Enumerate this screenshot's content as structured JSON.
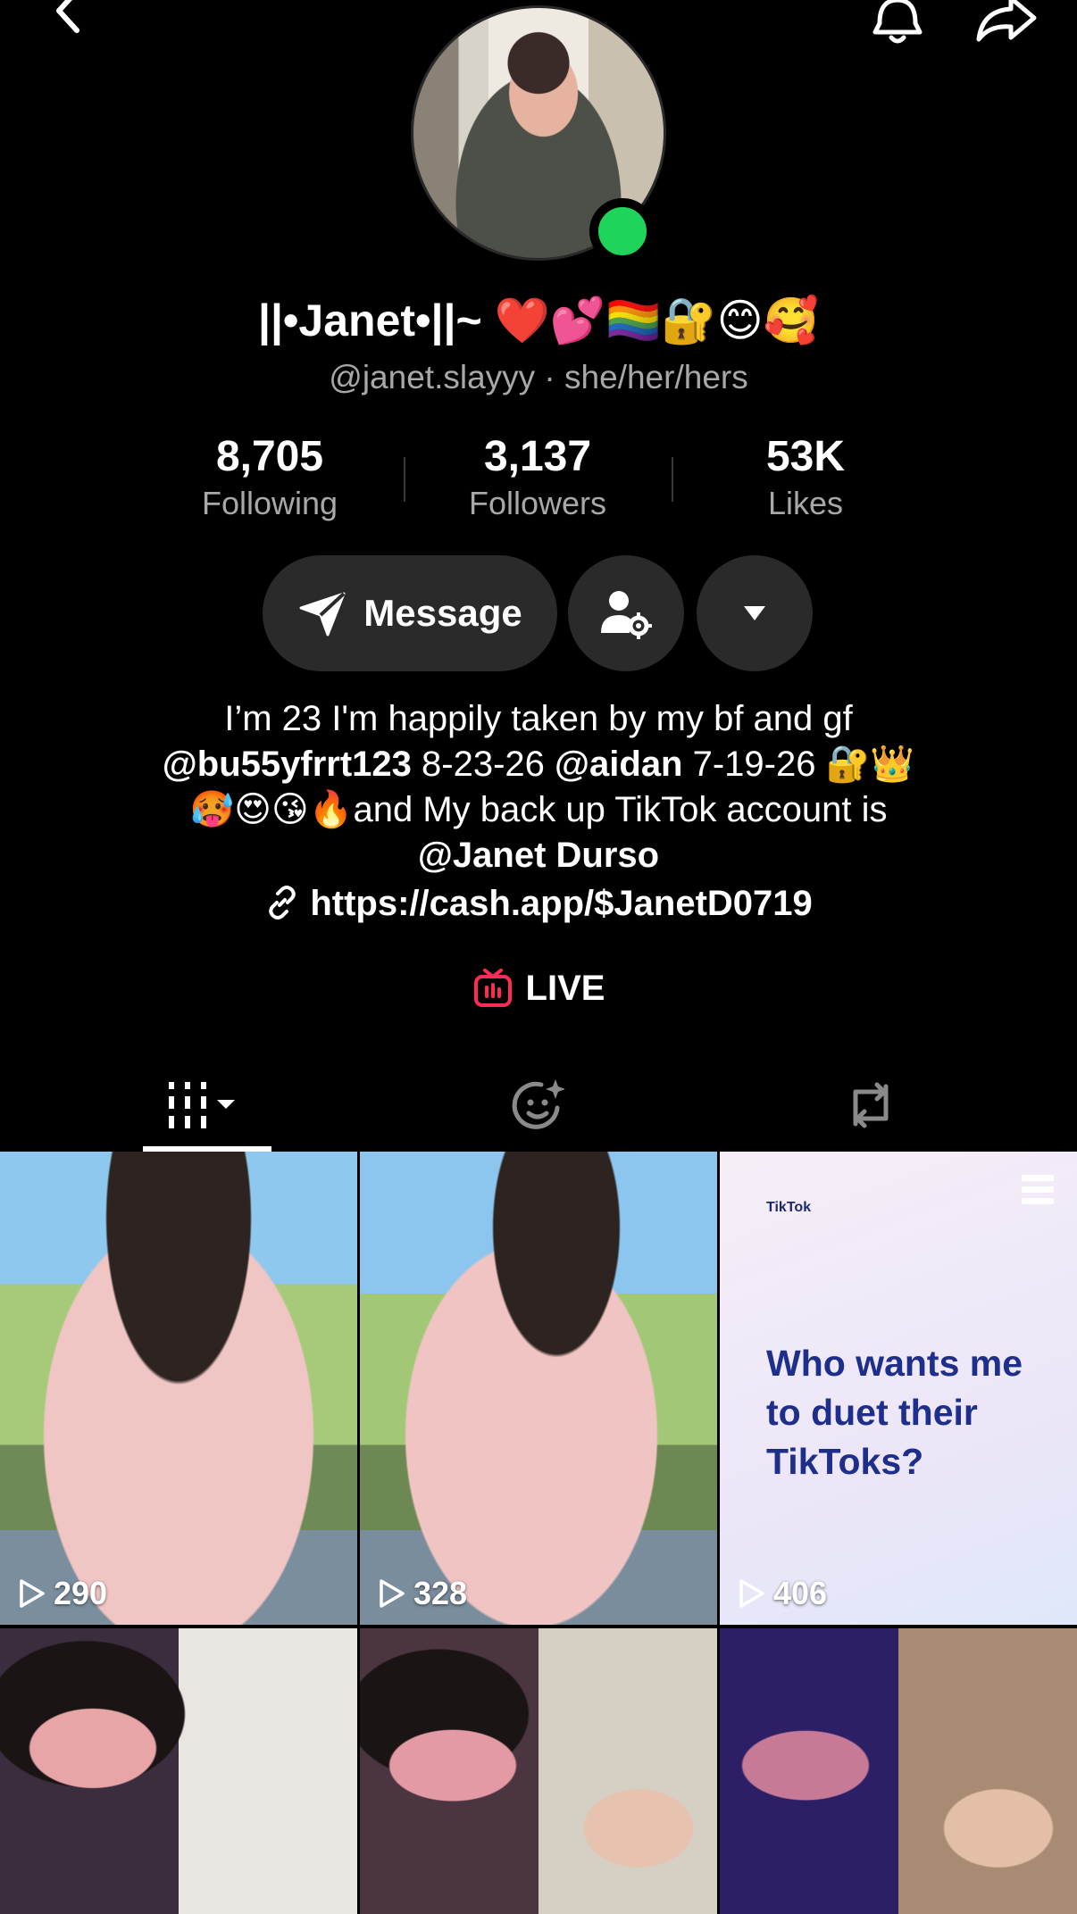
{
  "profile": {
    "display_name": "||•Janet•||~ ❤️💕🏳️‍🌈🔐😊🥰",
    "handle": "@janet.slayyy",
    "pronouns": "she/her/hers",
    "separator": " · "
  },
  "stats": [
    {
      "value": "8,705",
      "label": "Following"
    },
    {
      "value": "3,137",
      "label": "Followers"
    },
    {
      "value": "53K",
      "label": "Likes"
    }
  ],
  "actions": {
    "message_label": "Message"
  },
  "bio": {
    "line1": "I’m 23 I'm happily taken by my bf and gf",
    "mention1": "@bu55yfrrt123",
    "date1": " 8-23-26 ",
    "mention2": "@aidan",
    "date2": " 7-19-26 🔐👑",
    "line3": "🥵😍😘🔥and My back up TikTok account is",
    "mention3": "@Janet Durso"
  },
  "link": {
    "url": "https://cash.app/$JanetD0719"
  },
  "live": {
    "label": "LIVE",
    "accent_color": "#fe2c55"
  },
  "tabs": [
    {
      "name": "videos",
      "icon": "grid-icon",
      "selected": true
    },
    {
      "name": "favorites",
      "icon": "sparkle-face-icon",
      "selected": false
    },
    {
      "name": "reposts",
      "icon": "repost-icon",
      "selected": false
    }
  ],
  "videos": [
    {
      "views": "290"
    },
    {
      "views": "328"
    },
    {
      "views": "406",
      "brand": "TikTok",
      "text": "Who wants me to duet their TikToks?"
    },
    {
      "views": ""
    },
    {
      "views": ""
    },
    {
      "views": ""
    }
  ]
}
